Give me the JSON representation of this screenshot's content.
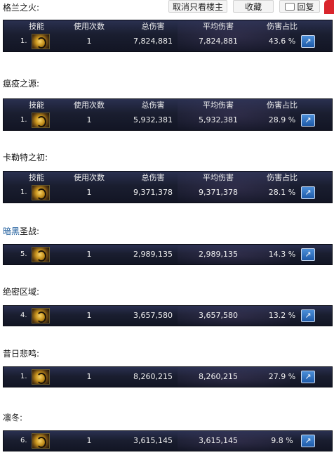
{
  "topbar": {
    "only_op_label": "取消只看楼主",
    "favorite_label": "收藏",
    "reply_label": "回复"
  },
  "table_header": {
    "skill": "技能",
    "uses": "使用次数",
    "total": "总伤害",
    "avg": "平均伤害",
    "pct": "伤害占比"
  },
  "sections": [
    {
      "title": "格兰之火:",
      "row": {
        "index": "1.",
        "uses": "1",
        "total": "7,824,881",
        "avg": "7,824,881",
        "pct": "43.6 %"
      }
    },
    {
      "title": "瘟疫之源:",
      "row": {
        "index": "1.",
        "uses": "1",
        "total": "5,932,381",
        "avg": "5,932,381",
        "pct": "28.9 %"
      }
    },
    {
      "title": "卡勒特之初:",
      "row": {
        "index": "1.",
        "uses": "1",
        "total": "9,371,378",
        "avg": "9,371,378",
        "pct": "28.1 %"
      }
    },
    {
      "title_link": "暗黑",
      "title": "圣战:",
      "row": {
        "index": "5.",
        "uses": "1",
        "total": "2,989,135",
        "avg": "2,989,135",
        "pct": "14.3 %"
      }
    },
    {
      "title": "绝密区域:",
      "row": {
        "index": "4.",
        "uses": "1",
        "total": "3,657,580",
        "avg": "3,657,580",
        "pct": "13.2 %"
      }
    },
    {
      "title": "昔日悲鸣:",
      "row": {
        "index": "1.",
        "uses": "1",
        "total": "8,260,215",
        "avg": "8,260,215",
        "pct": "27.9 %"
      }
    },
    {
      "title": "凛冬:",
      "row": {
        "index": "6.",
        "uses": "1",
        "total": "3,615,145",
        "avg": "3,615,145",
        "pct": "9.8 %"
      }
    }
  ]
}
